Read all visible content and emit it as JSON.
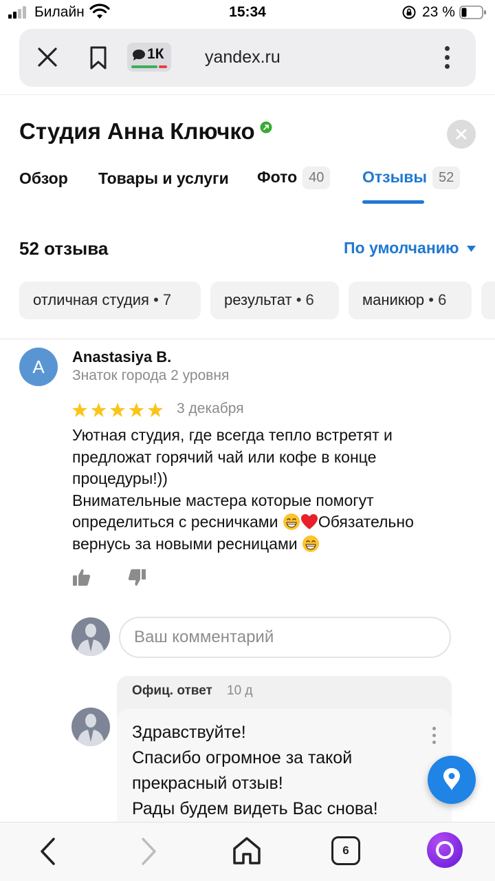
{
  "status_bar": {
    "carrier": "Билайн",
    "time": "15:34",
    "battery": "23 %"
  },
  "browser": {
    "url": "yandex.ru",
    "comments_count": "1К"
  },
  "business": {
    "title": "Студия Анна Ключко"
  },
  "tabs": [
    {
      "label": "Обзор",
      "count": ""
    },
    {
      "label": "Товары и услуги",
      "count": ""
    },
    {
      "label": "Фото",
      "count": "40"
    },
    {
      "label": "Отзывы",
      "count": "52"
    }
  ],
  "active_tab": "Отзывы",
  "reviews": {
    "count_label": "52 отзыва",
    "sort_label": "По умолчанию"
  },
  "chips": [
    {
      "label": "отличная студия",
      "count": " • 7"
    },
    {
      "label": "результат",
      "count": " • 6"
    },
    {
      "label": "маникюр",
      "count": " • 6"
    }
  ],
  "review": {
    "avatar_letter": "A",
    "author": "Anastasiya B.",
    "level": "Знаток города 2 уровня",
    "rating": 5,
    "date": "3 декабря",
    "text_line1": "Уютная студия, где всегда тепло встретят и предложат горячий чай или кофе в конце процедуры!))",
    "text_line2": "Внимательные мастера которые помогут определиться с ресничками",
    "text_line3": "Обязательно вернусь за новыми ресницами",
    "icons": [
      "thumb-up-icon",
      "thumb-down-icon"
    ]
  },
  "comment": {
    "placeholder": "Ваш комментарий"
  },
  "official_reply": {
    "label": "Офиц. ответ",
    "time": "10 д",
    "line1": "Здравствуйте!",
    "line2": "Спасибо огромное за такой прекрасный отзыв!",
    "line3": "Рады будем видеть Вас снова!"
  },
  "bottom_nav": {
    "tabs_count": "6"
  },
  "colors": {
    "accent": "#1f78d1",
    "star": "#fcc419",
    "avatar": "#5a95d3",
    "fab": "#1f84e6"
  }
}
